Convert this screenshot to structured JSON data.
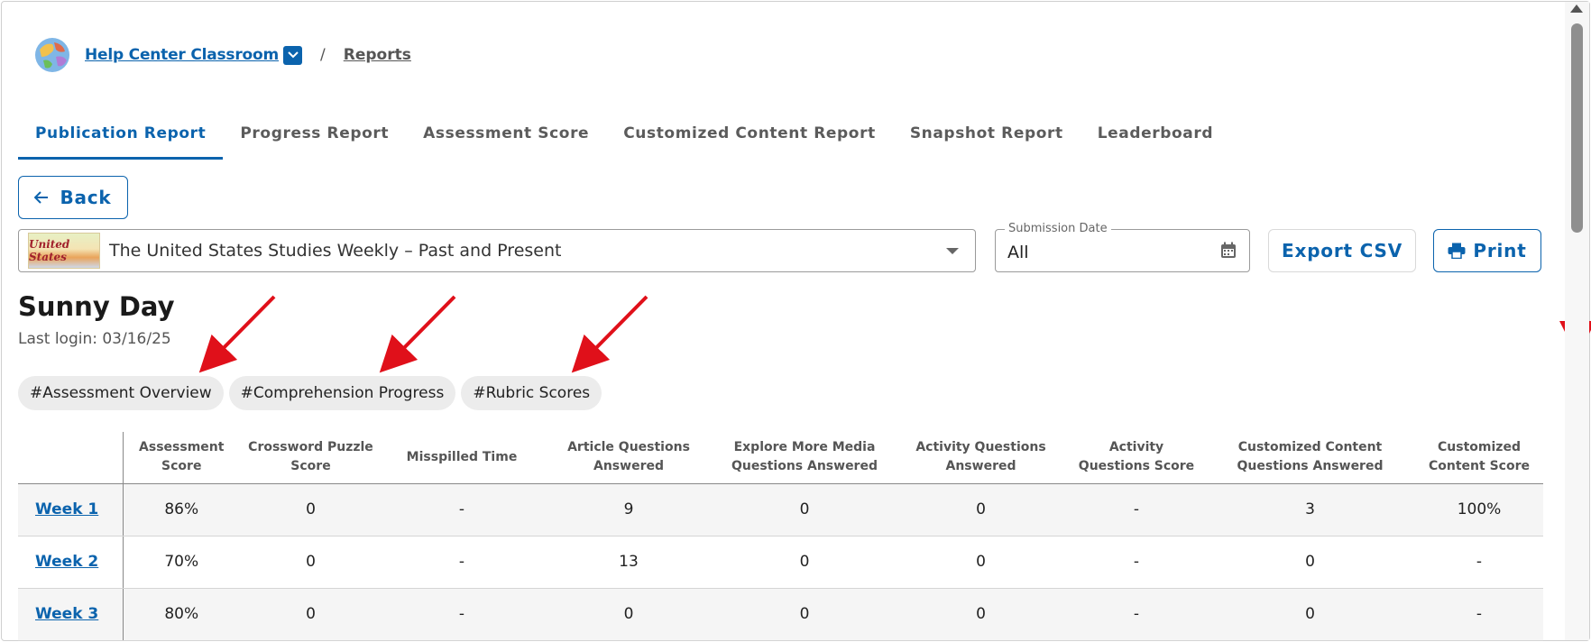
{
  "breadcrumb": {
    "classroom": "Help Center Classroom",
    "separator": "/",
    "current": "Reports"
  },
  "tabs": [
    {
      "label": "Publication Report",
      "active": true
    },
    {
      "label": "Progress Report",
      "active": false
    },
    {
      "label": "Assessment Score",
      "active": false
    },
    {
      "label": "Customized Content Report",
      "active": false
    },
    {
      "label": "Snapshot Report",
      "active": false
    },
    {
      "label": "Leaderboard",
      "active": false
    }
  ],
  "toolbar": {
    "back_label": "Back",
    "publication": "The United States Studies Weekly – Past and Present",
    "publication_thumb_text": "United States",
    "date_legend": "Submission Date",
    "date_value": "All",
    "export_label": "Export CSV",
    "print_label": "Print"
  },
  "student": {
    "name": "Sunny Day",
    "last_login": "Last login: 03/16/25"
  },
  "anchors": [
    "#Assessment Overview",
    "#Comprehension Progress",
    "#Rubric Scores"
  ],
  "table": {
    "headers": [
      "",
      "Assessment Score",
      "Crossword Puzzle Score",
      "Misspilled Time",
      "Article Questions Answered",
      "Explore More Media Questions Answered",
      "Activity Questions Answered",
      "Activity Questions Score",
      "Customized Content Questions Answered",
      "Customized Content Score"
    ],
    "rows": [
      {
        "week": "Week 1",
        "cells": [
          "86%",
          "0",
          "-",
          "9",
          "0",
          "0",
          "-",
          "3",
          "100%"
        ]
      },
      {
        "week": "Week 2",
        "cells": [
          "70%",
          "0",
          "-",
          "13",
          "0",
          "0",
          "-",
          "0",
          "-"
        ]
      },
      {
        "week": "Week 3",
        "cells": [
          "80%",
          "0",
          "-",
          "0",
          "0",
          "0",
          "-",
          "0",
          "-"
        ]
      }
    ]
  },
  "colors": {
    "accent": "#0b63ad",
    "annotation": "#e0101a"
  },
  "icons": {
    "globe": "globe-icon",
    "caret": "chevron-down-icon",
    "back": "arrow-left-icon",
    "calendar": "calendar-icon",
    "print": "printer-icon"
  }
}
